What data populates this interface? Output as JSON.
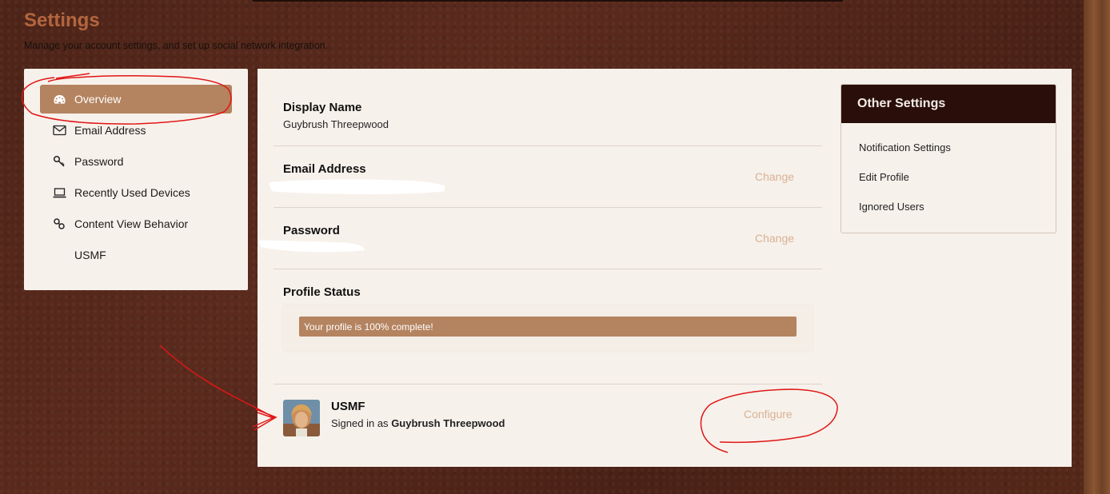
{
  "page": {
    "title": "Settings",
    "subtitle": "Manage your account settings, and set up social network integration."
  },
  "nav": {
    "items": [
      {
        "label": "Overview",
        "icon": "dashboard-icon"
      },
      {
        "label": "Email Address",
        "icon": "envelope-icon"
      },
      {
        "label": "Password",
        "icon": "key-icon"
      },
      {
        "label": "Recently Used Devices",
        "icon": "laptop-icon"
      },
      {
        "label": "Content View Behavior",
        "icon": "link-icon"
      },
      {
        "label": "USMF",
        "icon": ""
      }
    ],
    "active_index": 0
  },
  "main": {
    "display_name": {
      "title": "Display Name",
      "value": "Guybrush Threepwood"
    },
    "email": {
      "title": "Email Address",
      "action": "Change"
    },
    "password": {
      "title": "Password",
      "action": "Change"
    },
    "profile_status": {
      "title": "Profile Status",
      "message": "Your profile is 100% complete!",
      "percent": 100
    },
    "usmf": {
      "title": "USMF",
      "signed_in_prefix": "Signed in as",
      "user": "Guybrush Threepwood",
      "action": "Configure"
    }
  },
  "other_settings": {
    "title": "Other Settings",
    "links": [
      "Notification Settings",
      "Edit Profile",
      "Ignored Users"
    ]
  },
  "colors": {
    "accent": "#b4835f",
    "title": "#b2663f",
    "panel_header": "#2a0e09",
    "link_muted": "#d8b193",
    "annotation": "#e01616"
  }
}
